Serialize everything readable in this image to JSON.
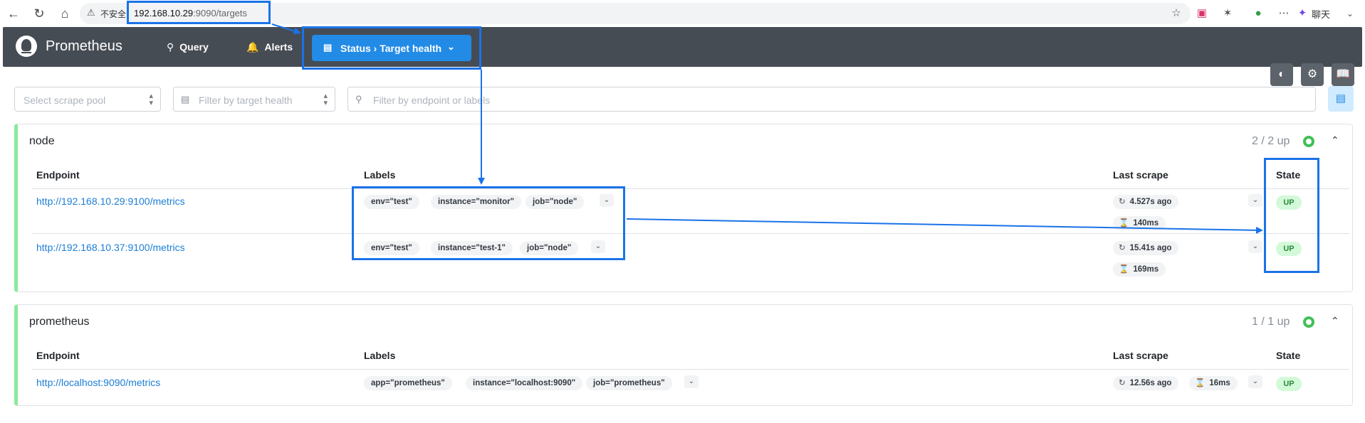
{
  "browser": {
    "back_icon": "arrow-left-icon",
    "security_label": "不安全",
    "url_host": "192.168.10.29",
    "url_rest": ":9090/targets",
    "chat_label": "聊天"
  },
  "nav": {
    "brand": "Prometheus",
    "query": "Query",
    "alerts": "Alerts",
    "status_menu": "Status › Target health",
    "theme_icon": "contrast-icon",
    "settings_icon": "gear-icon",
    "docs_icon": "book-icon"
  },
  "filters": {
    "scrape_pool_placeholder": "Select scrape pool",
    "health_placeholder": "Filter by target health",
    "search_placeholder": "Filter by endpoint or labels"
  },
  "table_headers": {
    "endpoint": "Endpoint",
    "labels": "Labels",
    "last_scrape": "Last scrape",
    "state": "State"
  },
  "pools": [
    {
      "name": "node",
      "count": "2 / 2 up",
      "targets": [
        {
          "endpoint": "http://192.168.10.29:9100/metrics",
          "labels": [
            "env=\"test\"",
            "instance=\"monitor\"",
            "job=\"node\""
          ],
          "last_scrape": "4.527s ago",
          "duration": "140ms",
          "state": "UP"
        },
        {
          "endpoint": "http://192.168.10.37:9100/metrics",
          "labels": [
            "env=\"test\"",
            "instance=\"test-1\"",
            "job=\"node\""
          ],
          "last_scrape": "15.41s ago",
          "duration": "169ms",
          "state": "UP"
        }
      ]
    },
    {
      "name": "prometheus",
      "count": "1 / 1 up",
      "targets": [
        {
          "endpoint": "http://localhost:9090/metrics",
          "labels": [
            "app=\"prometheus\"",
            "instance=\"localhost:9090\"",
            "job=\"prometheus\""
          ],
          "last_scrape": "12.56s ago",
          "duration": "16ms",
          "state": "UP"
        }
      ]
    }
  ],
  "colors": {
    "accent": "#228be6",
    "navbar": "#464c54",
    "healthy": "#40c057",
    "annotation": "#1a73e8"
  }
}
